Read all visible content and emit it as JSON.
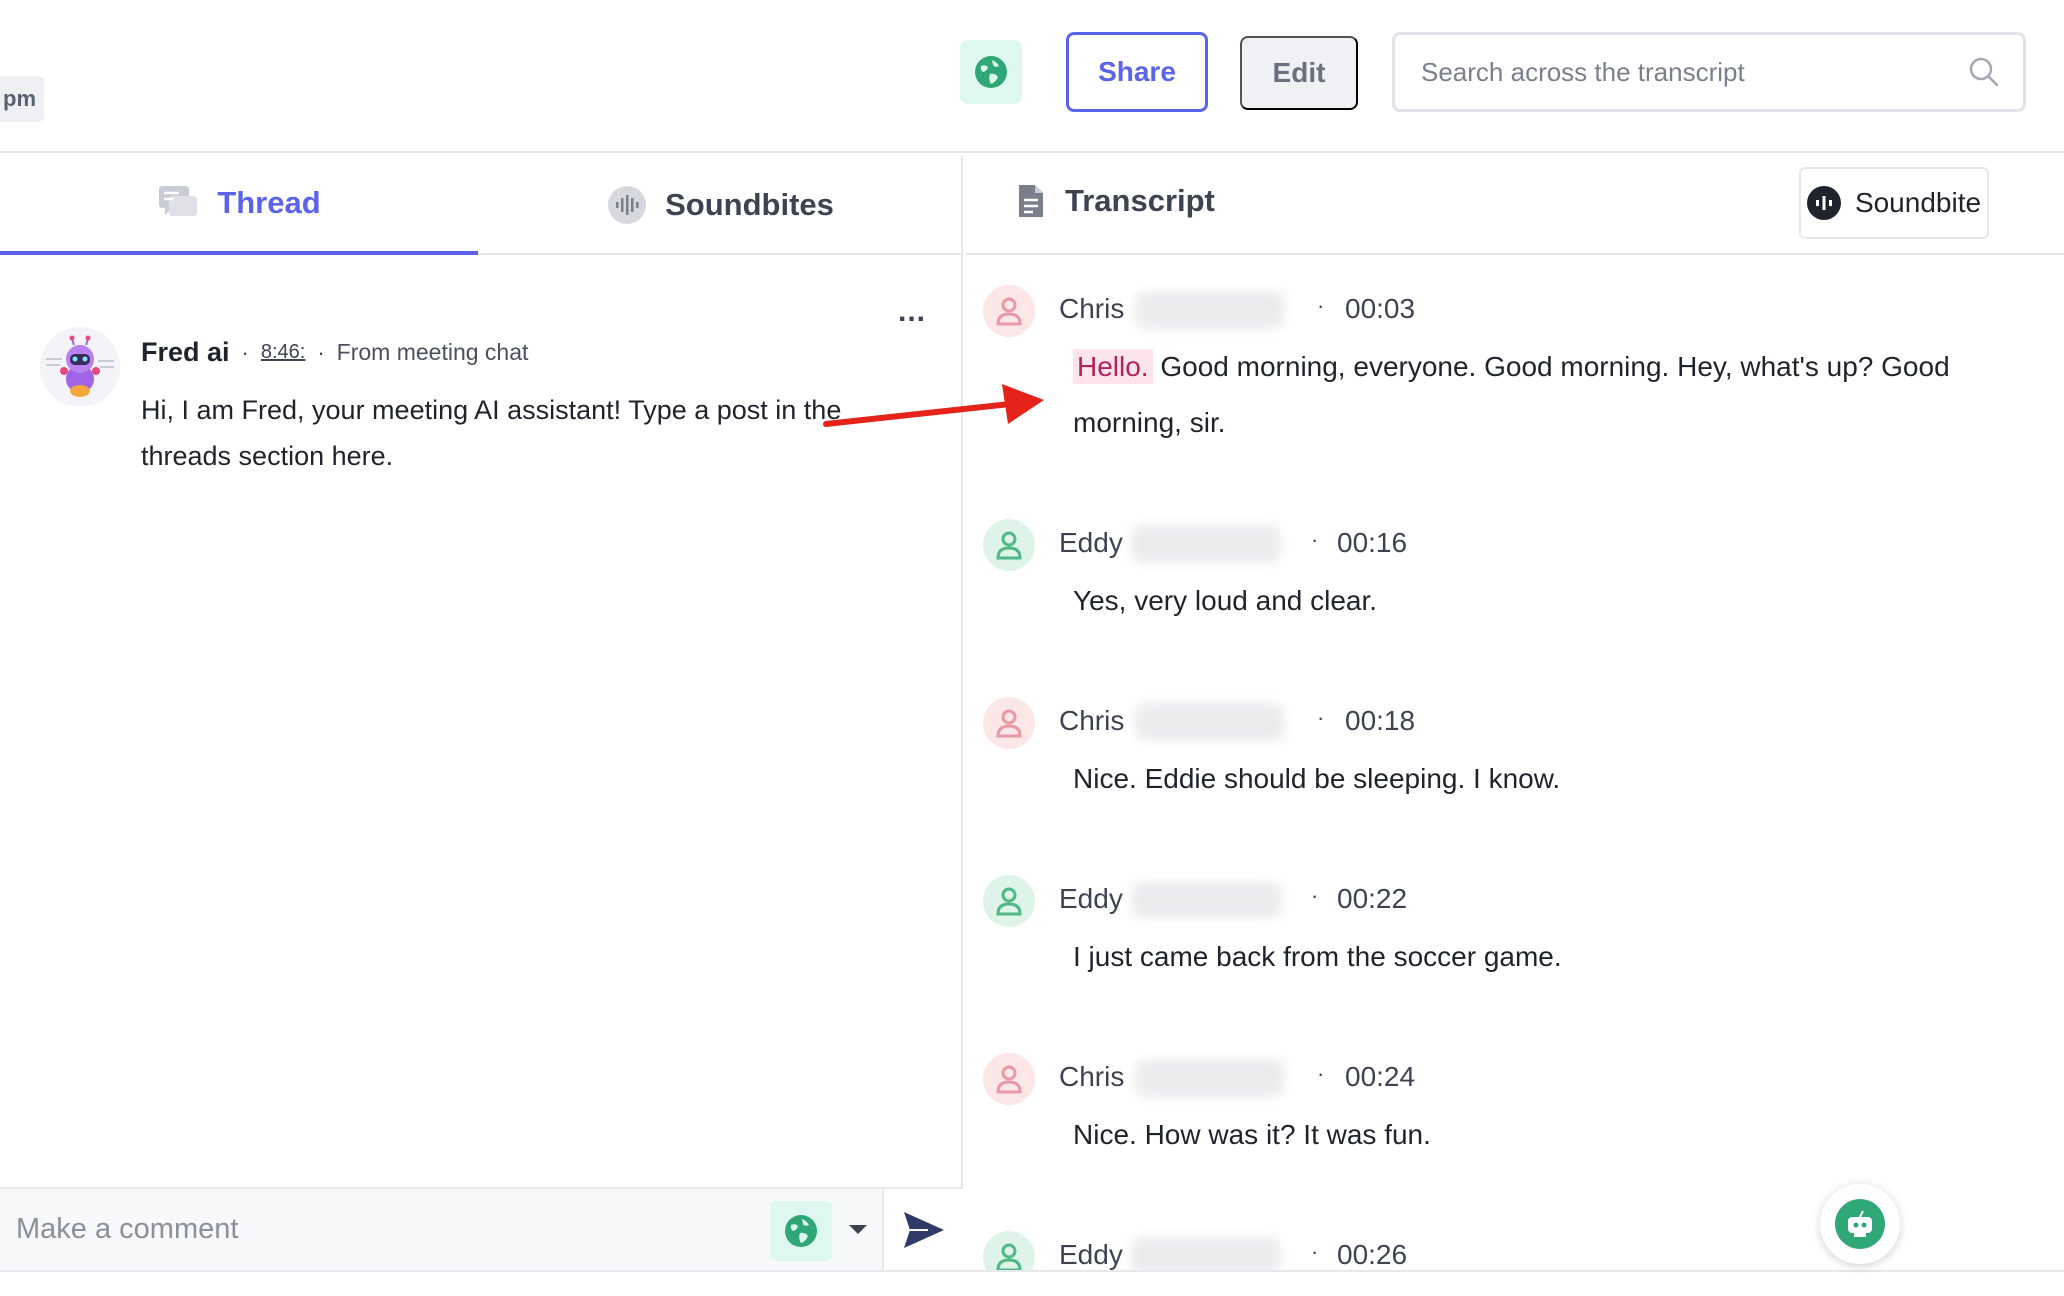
{
  "topbar": {
    "time_chip": "pm",
    "share_label": "Share",
    "edit_label": "Edit",
    "search_placeholder": "Search across the transcript",
    "accent_color": "#5b63e8"
  },
  "left_panel": {
    "tabs": [
      {
        "label": "Thread",
        "icon": "chat-icon",
        "active": true
      },
      {
        "label": "Soundbites",
        "icon": "waveform-icon",
        "active": false
      }
    ],
    "more_label": "...",
    "message": {
      "author": "Fred ai",
      "time": "8:46:",
      "source": "From meeting chat",
      "text": "Hi, I am Fred, your meeting AI assistant! Type a post in the threads section here."
    },
    "comment": {
      "placeholder": "Make a comment"
    }
  },
  "right_panel": {
    "title": "Transcript",
    "soundbite_label": "Soundbite",
    "entries": [
      {
        "speaker": "Chris",
        "time": "00:03",
        "highlight": "Hello.",
        "text": "Good morning, everyone. Good morning. Hey, what's up? Good morning, sir."
      },
      {
        "speaker": "Eddy",
        "time": "00:16",
        "text": "Yes, very loud and clear."
      },
      {
        "speaker": "Chris",
        "time": "00:18",
        "text": "Nice. Eddie should be sleeping. I know."
      },
      {
        "speaker": "Eddy",
        "time": "00:22",
        "text": "I just came back from the soccer game."
      },
      {
        "speaker": "Chris",
        "time": "00:24",
        "text": "Nice. How was it? It was fun."
      },
      {
        "speaker": "Eddy",
        "time": "00:26",
        "text": ""
      }
    ]
  }
}
